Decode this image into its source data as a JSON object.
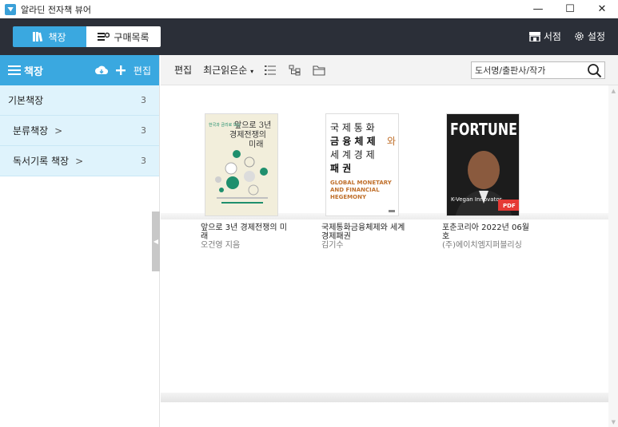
{
  "window": {
    "title": "알라딘 전자책 뷰어",
    "controls": {
      "minimize": "—",
      "maximize": "☐",
      "close": "✕"
    }
  },
  "header": {
    "tabs": [
      {
        "label": "책장",
        "icon": "bookshelf-icon",
        "active": true
      },
      {
        "label": "구매목록",
        "icon": "purchase-list-icon",
        "active": false
      }
    ],
    "right": [
      {
        "label": "서점",
        "icon": "store-icon"
      },
      {
        "label": "설정",
        "icon": "gear-icon"
      }
    ]
  },
  "sidebar": {
    "title": "책장",
    "edit_label": "편집",
    "items": [
      {
        "label": "기본책장",
        "count": "3"
      },
      {
        "label": "분류책장",
        "count": "3"
      },
      {
        "label": "독서기록 책장",
        "count": "3"
      }
    ]
  },
  "toolbar": {
    "edit_label": "편집",
    "sort_label": "최근읽은순",
    "search_placeholder": "도서명/출판사/작가"
  },
  "books": [
    {
      "title": "앞으로 3년 경제전쟁의 미래",
      "author": "오건영 지음",
      "cover_text": {
        "top": "앞으로 3년",
        "mid": "경제전쟁의",
        "bottom": "미래",
        "badge": "한국과 금리로 보는"
      }
    },
    {
      "title": "국제통화금융체제와 세계경제패권",
      "author": "김기수",
      "cover_text": {
        "l1": "국 제 통 화",
        "l2": "금 융 체 제",
        "l2b": "와",
        "l3": "세 계 경 제",
        "l4": "패 권",
        "en1": "GLOBAL MONETARY",
        "en2": "AND FINANCIAL",
        "en3": "HEGEMONY"
      }
    },
    {
      "title": "포춘코리아 2022년 06월호",
      "author": "(주)에이치엠지퍼블리싱",
      "cover_text": {
        "masthead": "FORTUNE",
        "tagline": "K-Vegan Innovator",
        "badge": "PDF"
      }
    }
  ],
  "colors": {
    "accent": "#3aa8e0",
    "header_bg": "#2b2f38",
    "sidebar_item_bg": "#dff3fc"
  }
}
